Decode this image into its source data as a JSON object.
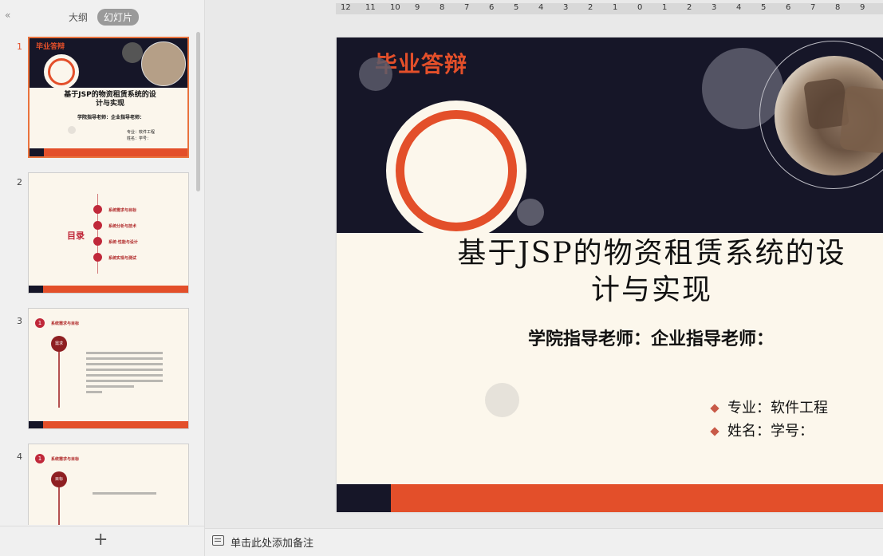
{
  "left_panel": {
    "tabs": [
      "大纲",
      "幻灯片"
    ],
    "active_tab": "幻灯片",
    "thumbnails": [
      {
        "number": "1",
        "brand": "毕业答辩",
        "title_line1": "基于JSP的物资租赁系统的设",
        "title_line2": "计与实现",
        "subtitle": "学院指导老师：企业指导老师：",
        "info1": "专业：软件工程",
        "info2": "姓名：学号："
      },
      {
        "number": "2",
        "toc_title": "目录",
        "items": [
          "系统需求与目标",
          "系统分析与技术",
          "系统·性能与设计",
          "系统实现与测试"
        ]
      },
      {
        "number": "3",
        "section_num": "1",
        "section_title": "系统需求与目标",
        "tag": "需求"
      },
      {
        "number": "4",
        "section_num": "1",
        "section_title": "系统需求与目标",
        "tag": "目标"
      }
    ]
  },
  "ruler": {
    "labels": [
      "12",
      "11",
      "10",
      "9",
      "8",
      "7",
      "6",
      "5",
      "4",
      "3",
      "2",
      "1",
      "0",
      "1",
      "2",
      "3",
      "4",
      "5",
      "6",
      "7",
      "8",
      "9"
    ]
  },
  "slide": {
    "brand": "毕业答辩",
    "title_line1": "基于JSP的物资租赁系统的设",
    "title_line2": "计与实现",
    "subtitle": "学院指导老师：企业指导老师：",
    "info": [
      "专业：软件工程",
      "姓名：学号："
    ]
  },
  "notes": {
    "placeholder": "单击此处添加备注"
  },
  "colors": {
    "accent": "#e34f2a",
    "dark": "#161628",
    "cream": "#fcf7ec"
  }
}
